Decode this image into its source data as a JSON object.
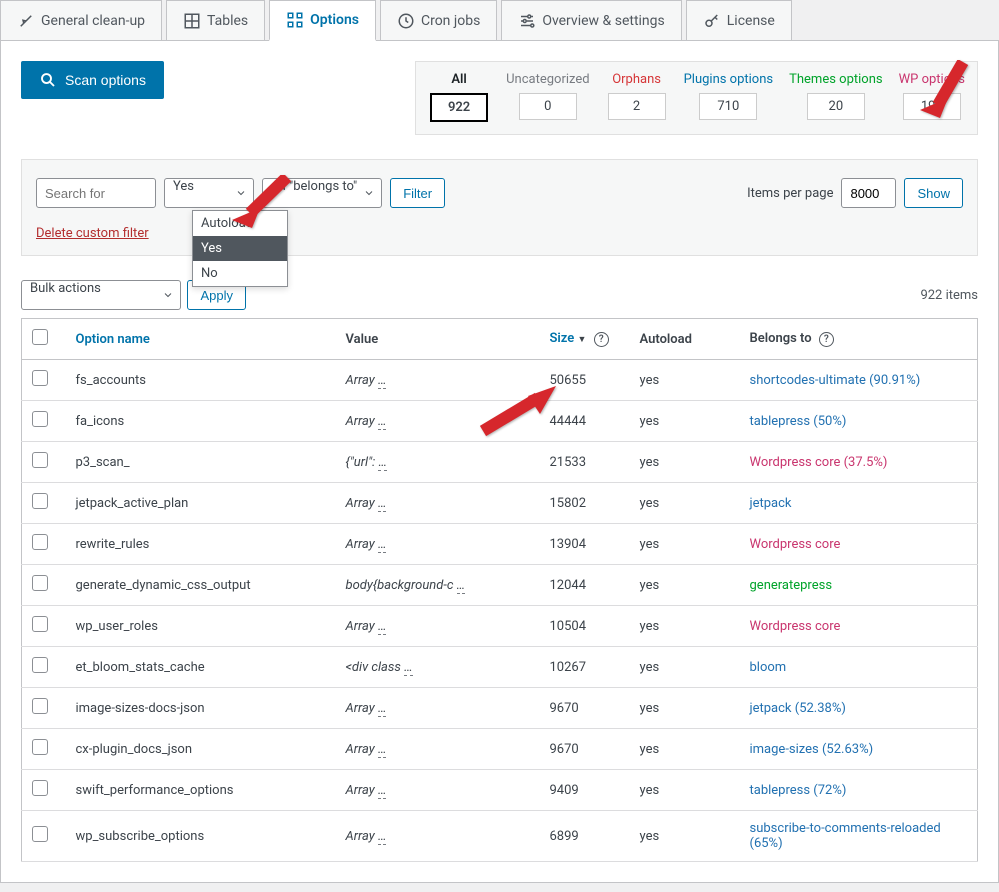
{
  "tabs": [
    {
      "label": "General clean-up"
    },
    {
      "label": "Tables"
    },
    {
      "label": "Options"
    },
    {
      "label": "Cron jobs"
    },
    {
      "label": "Overview & settings"
    },
    {
      "label": "License"
    }
  ],
  "scan_label": "Scan options",
  "categories": {
    "all": {
      "label": "All",
      "count": "922"
    },
    "uncat": {
      "label": "Uncategorized",
      "count": "0"
    },
    "orphans": {
      "label": "Orphans",
      "count": "2"
    },
    "plugins": {
      "label": "Plugins options",
      "count": "710"
    },
    "themes": {
      "label": "Themes options",
      "count": "20"
    },
    "wp": {
      "label": "WP options",
      "count": "190"
    }
  },
  "filters": {
    "search_placeholder": "Search for",
    "autoload_value": "Yes",
    "belongs_value": "All \"belongs to\"",
    "filter_btn": "Filter",
    "items_per_page_label": "Items per page",
    "items_per_page_value": "8000",
    "show_btn": "Show",
    "delete_filter": "Delete custom filter",
    "dropdown": [
      "Autoload",
      "Yes",
      "No"
    ]
  },
  "bulk": {
    "label": "Bulk actions",
    "apply": "Apply"
  },
  "items_count": "922 items",
  "columns": {
    "name": "Option name",
    "value": "Value",
    "size": "Size",
    "autoload": "Autoload",
    "belongs": "Belongs to"
  },
  "rows": [
    {
      "name": "fs_accounts",
      "value": "Array …",
      "size": "50655",
      "autoload": "yes",
      "belongs": "shortcodes-ultimate (90.91%)",
      "cls": "link-blue"
    },
    {
      "name": "fa_icons",
      "value": "Array …",
      "size": "44444",
      "autoload": "yes",
      "belongs": "tablepress (50%)",
      "cls": "link-blue"
    },
    {
      "name": "p3_scan_",
      "value": "{\"url\": …",
      "size": "21533",
      "autoload": "yes",
      "belongs": "Wordpress core (37.5%)",
      "cls": "link-pink"
    },
    {
      "name": "jetpack_active_plan",
      "value": "Array …",
      "size": "15802",
      "autoload": "yes",
      "belongs": "jetpack",
      "cls": "link-blue"
    },
    {
      "name": "rewrite_rules",
      "value": "Array …",
      "size": "13904",
      "autoload": "yes",
      "belongs": "Wordpress core",
      "cls": "link-pink"
    },
    {
      "name": "generate_dynamic_css_output",
      "value": "body{background-c …",
      "size": "12044",
      "autoload": "yes",
      "belongs": "generatepress",
      "cls": "link-green"
    },
    {
      "name": "wp_user_roles",
      "value": "Array …",
      "size": "10504",
      "autoload": "yes",
      "belongs": "Wordpress core",
      "cls": "link-pink"
    },
    {
      "name": "et_bloom_stats_cache",
      "value": "<div class …",
      "size": "10267",
      "autoload": "yes",
      "belongs": "bloom",
      "cls": "link-blue"
    },
    {
      "name": "image-sizes-docs-json",
      "value": "Array …",
      "size": "9670",
      "autoload": "yes",
      "belongs": "jetpack (52.38%)",
      "cls": "link-blue"
    },
    {
      "name": "cx-plugin_docs_json",
      "value": "Array …",
      "size": "9670",
      "autoload": "yes",
      "belongs": "image-sizes (52.63%)",
      "cls": "link-blue"
    },
    {
      "name": "swift_performance_options",
      "value": "Array …",
      "size": "9409",
      "autoload": "yes",
      "belongs": "tablepress (72%)",
      "cls": "link-blue"
    },
    {
      "name": "wp_subscribe_options",
      "value": "Array …",
      "size": "6899",
      "autoload": "yes",
      "belongs": "subscribe-to-comments-reloaded (65%)",
      "cls": "link-blue"
    }
  ]
}
